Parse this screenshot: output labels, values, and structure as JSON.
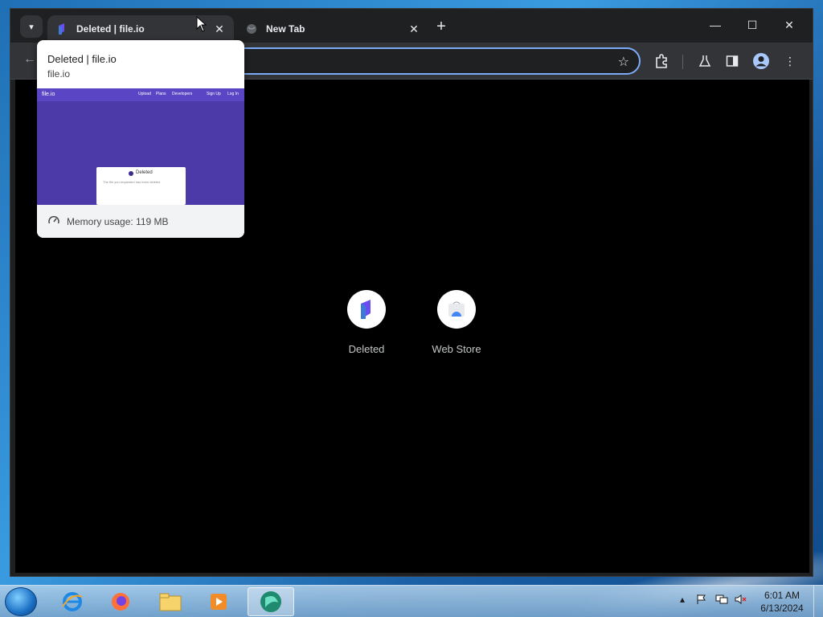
{
  "browser": {
    "tabs": [
      {
        "title": "Deleted | file.io",
        "active": true
      },
      {
        "title": "New Tab",
        "active": false
      }
    ],
    "new_tab_symbol": "+",
    "window_controls": {
      "minimize": "—",
      "maximize": "☐",
      "close": "✕"
    }
  },
  "hover_card": {
    "title": "Deleted | file.io",
    "domain": "file.io",
    "thumbnail": {
      "logo": "file.io",
      "nav": [
        "Upload",
        "Plans",
        "Developers",
        "Sign Up",
        "Log In"
      ],
      "card_title": "Deleted",
      "card_text": "The file you requested has been deleted"
    },
    "memory_usage": "Memory usage: 119 MB"
  },
  "new_tab_page": {
    "shortcuts": [
      {
        "label": "Deleted",
        "icon": "file-io-icon"
      },
      {
        "label": "Web Store",
        "icon": "web-store-icon"
      }
    ]
  },
  "taskbar": {
    "apps": [
      "internet-explorer-icon",
      "firefox-icon",
      "file-explorer-icon",
      "media-player-icon",
      "browser-icon"
    ],
    "clock": {
      "time": "6:01 AM",
      "date": "6/13/2024"
    }
  },
  "colors": {
    "accent": "#7cacf8",
    "tab_active": "#333437",
    "titlebar": "#1f2022",
    "fileio_purple": "#4b3aa8"
  }
}
